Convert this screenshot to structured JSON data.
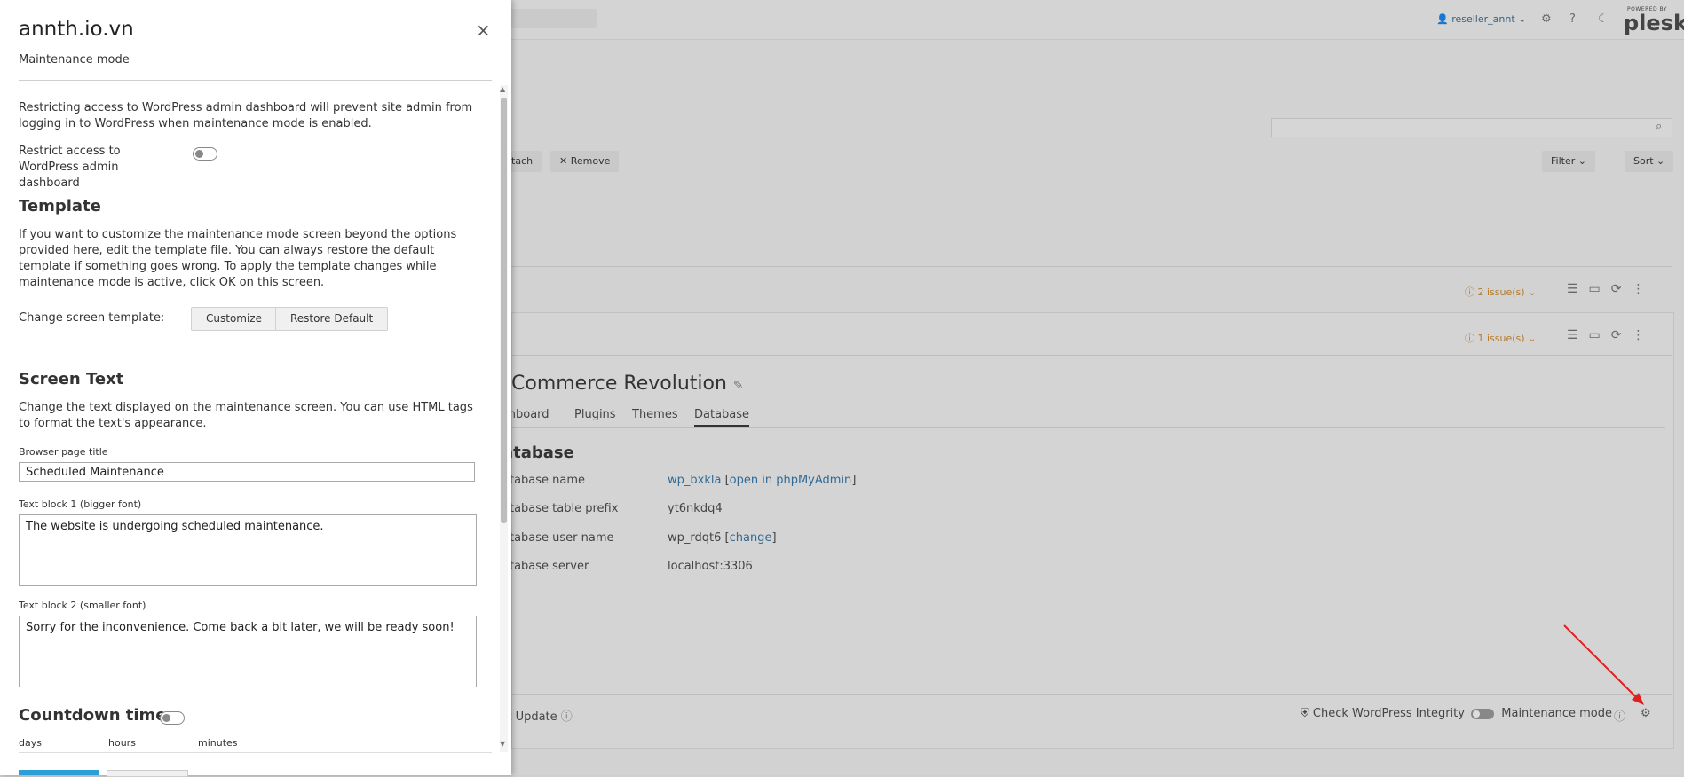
{
  "panel": {
    "title": "annth.io.vn",
    "subtitle": "Maintenance mode",
    "close_symbol": "×",
    "intro_text": "Restricting access to WordPress admin dashboard will prevent site admin from logging in to WordPress when maintenance mode is enabled.",
    "restrict_label": "Restrict access to WordPress admin dashboard",
    "template_heading": "Template",
    "template_text": "If you want to customize the maintenance mode screen beyond the options provided here, edit the template file. You can always restore the default template if something goes wrong. To apply the template changes while maintenance mode is active, click OK on this screen.",
    "change_template_label": "Change screen template:",
    "customize_button": "Customize",
    "restore_button": "Restore Default",
    "screen_text_heading": "Screen Text",
    "screen_text_desc": "Change the text displayed on the maintenance screen. You can use HTML tags to format the text's appearance.",
    "browser_title_label": "Browser page title",
    "browser_title_value": "Scheduled Maintenance",
    "text_block1_label": "Text block 1 (bigger font)",
    "text_block1_value": "The website is undergoing scheduled maintenance.",
    "text_block2_label": "Text block 2 (smaller font)",
    "text_block2_value": "Sorry for the inconvenience. Come back a bit later, we will be ready soon!",
    "countdown_heading": "Countdown timer",
    "days_label": "days",
    "hours_label": "hours",
    "minutes_label": "minutes"
  },
  "background": {
    "user": "reseller_annt ⌄",
    "logo_small": "POWERED BY",
    "logo_big": "plesk",
    "attach_button": "tach",
    "remove_button": "✕  Remove",
    "filter_button": "Filter ⌄",
    "sort_button": "Sort ⌄",
    "issue1": "2 issue(s) ⌄",
    "issue2": "1 issue(s) ⌄",
    "site_title": "Commerce Revolution",
    "tabs": [
      "shboard",
      "Plugins",
      "Themes",
      "Database"
    ],
    "db_heading": "atabase",
    "db_rows": [
      {
        "label": "atabase name",
        "value": "wp_bxkla",
        "link": "open in phpMyAdmin"
      },
      {
        "label": "atabase table prefix",
        "value": "yt6nkdq4_"
      },
      {
        "label": "atabase user name",
        "value": "wp_rdqt6",
        "link": "change"
      },
      {
        "label": "atabase server",
        "value": "localhost:3306"
      }
    ],
    "smart_update": "rt Update",
    "check_integrity": "Check WordPress Integrity",
    "maintenance_mode": "Maintenance mode"
  },
  "colors": {
    "link": "#2f6a96",
    "issue": "#b47a2b",
    "arrow": "#e02020",
    "primary_button": "#2d9fd8"
  }
}
